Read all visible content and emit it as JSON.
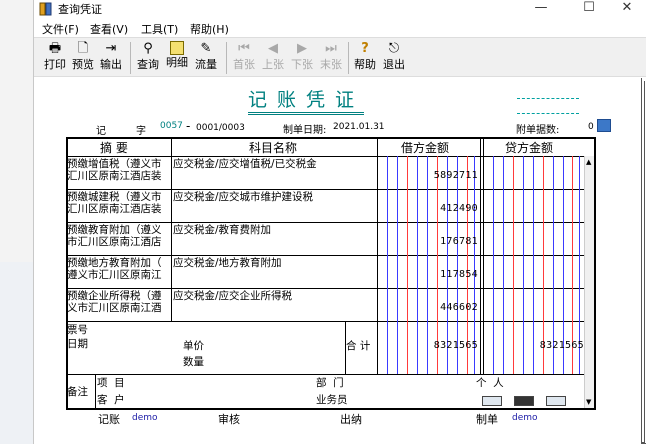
{
  "window": {
    "title": "查询凭证",
    "minimize": "—",
    "maximize": "☐",
    "close": "✕"
  },
  "menu": [
    "文件(F)",
    "查看(V)",
    "工具(T)",
    "帮助(H)"
  ],
  "toolbar": {
    "print": "打印",
    "preview": "预览",
    "export": "输出",
    "query": "查询",
    "detail": "明细",
    "flow": "流量",
    "first": "首张",
    "prev": "上张",
    "next": "下张",
    "last": "末张",
    "help": "帮助",
    "exit": "退出"
  },
  "voucher": {
    "title": "记账凭证",
    "type_label": "记",
    "zi": "字",
    "number": "0057",
    "dash": "-",
    "page": "0001/0003",
    "date_label": "制单日期:",
    "date": "2021.01.31",
    "attach_label": "附单据数:",
    "attach_count": "0"
  },
  "table": {
    "headers": {
      "summary": "摘 要",
      "account": "科目名称",
      "debit": "借方金额",
      "credit": "贷方金额"
    },
    "rows": [
      {
        "summary_l1": "预缴增值税（遵义市",
        "summary_l2": "汇川区原南江酒店装",
        "account": "应交税金/应交增值税/已交税金",
        "debit": "5892711",
        "credit": ""
      },
      {
        "summary_l1": "预缴城建税（遵义市",
        "summary_l2": "汇川区原南江酒店装",
        "account": "应交税金/应交城市维护建设税",
        "debit": "412490",
        "credit": ""
      },
      {
        "summary_l1": "预缴教育附加（遵义",
        "summary_l2": "市汇川区原南江酒店",
        "account": "应交税金/教育费附加",
        "debit": "176781",
        "credit": ""
      },
      {
        "summary_l1": "预缴地方教育附加（",
        "summary_l2": "遵义市汇川区原南江",
        "account": "应交税金/地方教育附加",
        "debit": "117854",
        "credit": ""
      },
      {
        "summary_l1": "预缴企业所得税（遵",
        "summary_l2": "义市汇川区原南江酒",
        "account": "应交税金/应交企业所得税",
        "debit": "446602",
        "credit": ""
      }
    ],
    "ticket_label": "票号",
    "date_label": "日期",
    "unit_price_label": "单价",
    "quantity_label": "数量",
    "total_label": "合 计",
    "total_debit": "8321565",
    "total_credit": "8321565",
    "remark_label": "备注",
    "project_label": "项  目",
    "customer_label": "客  户",
    "dept_label": "部  门",
    "person_label": "个  人",
    "salesman_label": "业务员"
  },
  "footer": {
    "bookkeeper_label": "记账",
    "bookkeeper": "demo",
    "reviewer_label": "审核",
    "cashier_label": "出纳",
    "maker_label": "制单",
    "maker": "demo"
  }
}
